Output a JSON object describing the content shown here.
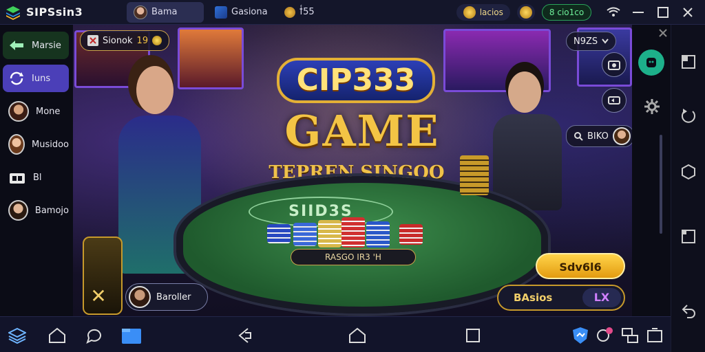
{
  "app": {
    "title": "SIPSsin3"
  },
  "tabs": [
    {
      "label": "Bama"
    },
    {
      "label": "Gasiona"
    },
    {
      "label": "ꝉ͑55"
    }
  ],
  "top_pills": {
    "coins_label": "lacios",
    "balance_label": "8 cio1co"
  },
  "sidebar": {
    "items": [
      {
        "label": "Marsie",
        "icon": "back-arrow-icon"
      },
      {
        "label": "Iuns",
        "icon": "refresh-icon"
      },
      {
        "label": "Mone",
        "icon": "avatar"
      },
      {
        "label": "Musidoo",
        "icon": "avatar"
      },
      {
        "label": "Bl",
        "icon": "folder-icon"
      },
      {
        "label": "Bamojo",
        "icon": "avatar"
      }
    ]
  },
  "game": {
    "badge_label": "Sionok",
    "badge_count": "19",
    "title_logo": "CIP333",
    "title_main": "GAME",
    "title_sub": "TEPREN SINGOO",
    "table_logo": "SIID3S",
    "bet_label": "RASGO IR3 'H",
    "top_right_label": "N9ZS",
    "player_label": "Baroller",
    "right_chip_label": "BIKO",
    "gold_button": "Sdv6l6",
    "dark_button": "BAsios",
    "dark_button_x": "LX"
  },
  "colors": {
    "accent_purple": "#4b3fb8",
    "accent_green": "#2aa35a",
    "gold": "#f3c445"
  }
}
